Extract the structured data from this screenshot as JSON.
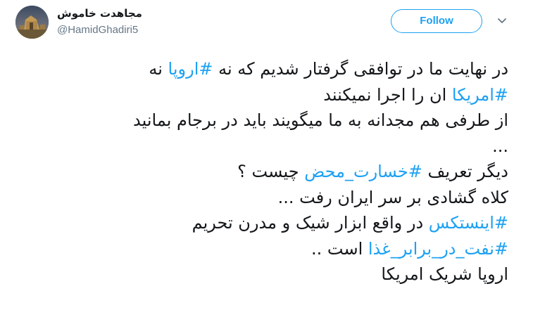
{
  "tweet": {
    "display_name": "مجاهدت خاموش",
    "handle": "@HamidGhadiri5",
    "follow_label": "Follow",
    "avatar_icon": "profile-photo-castle",
    "caret_icon": "chevron-down-icon",
    "colors": {
      "accent": "#1da1f2",
      "text": "#14171a",
      "secondary": "#657786"
    },
    "lines": [
      {
        "p1": "در نهایت ما در توافقی گرفتار شدیم که نه ",
        "tag": "#اروپا",
        "p2": " نه"
      },
      {
        "p1": "",
        "tag": "#امریکا",
        "p2": " ان را اجرا نمیکنند"
      },
      {
        "p1": "از طرفی هم مجدانه به ما میگویند باید در برجام بمانید",
        "tag": "",
        "p2": ""
      },
      {
        "p1": "...",
        "tag": "",
        "p2": ""
      },
      {
        "p1": "دیگر تعریف ",
        "tag": "#خسارت_محض",
        "p2": " چیست ؟"
      },
      {
        "p1": "کلاه گشادی بر سر ایران رفت ...",
        "tag": "",
        "p2": ""
      },
      {
        "p1": "",
        "tag": "#اینستکس",
        "p2": " در واقع ابزار شیک و مدرن تحریم"
      },
      {
        "p1": "",
        "tag": "#نفت_در_برابر_غذا",
        "p2": " است .."
      },
      {
        "p1": "اروپا شریک امریکا",
        "tag": "",
        "p2": ""
      }
    ]
  }
}
